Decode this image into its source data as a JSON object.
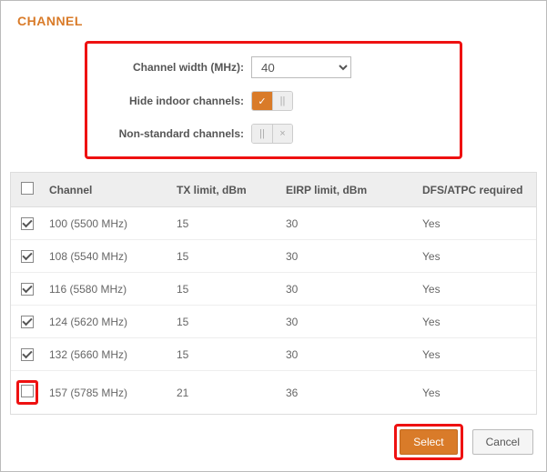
{
  "header": {
    "title": "CHANNEL"
  },
  "settings": {
    "channel_width_label": "Channel width (MHz):",
    "channel_width_value": "40",
    "hide_indoor_label": "Hide indoor channels:",
    "hide_indoor_on": true,
    "nonstandard_label": "Non-standard channels:",
    "nonstandard_on": false
  },
  "table": {
    "headers": {
      "channel": "Channel",
      "tx": "TX limit, dBm",
      "eirp": "EIRP limit, dBm",
      "dfs": "DFS/ATPC required"
    },
    "rows": [
      {
        "checked": true,
        "channel": "100 (5500 MHz)",
        "tx": "15",
        "eirp": "30",
        "dfs": "Yes"
      },
      {
        "checked": true,
        "channel": "108 (5540 MHz)",
        "tx": "15",
        "eirp": "30",
        "dfs": "Yes"
      },
      {
        "checked": true,
        "channel": "116 (5580 MHz)",
        "tx": "15",
        "eirp": "30",
        "dfs": "Yes"
      },
      {
        "checked": true,
        "channel": "124 (5620 MHz)",
        "tx": "15",
        "eirp": "30",
        "dfs": "Yes"
      },
      {
        "checked": true,
        "channel": "132 (5660 MHz)",
        "tx": "15",
        "eirp": "30",
        "dfs": "Yes"
      },
      {
        "checked": false,
        "channel": "157 (5785 MHz)",
        "tx": "21",
        "eirp": "36",
        "dfs": "Yes"
      }
    ]
  },
  "footer": {
    "select_label": "Select",
    "cancel_label": "Cancel"
  },
  "icons": {
    "check": "✓",
    "pause": "||",
    "x": "×"
  }
}
